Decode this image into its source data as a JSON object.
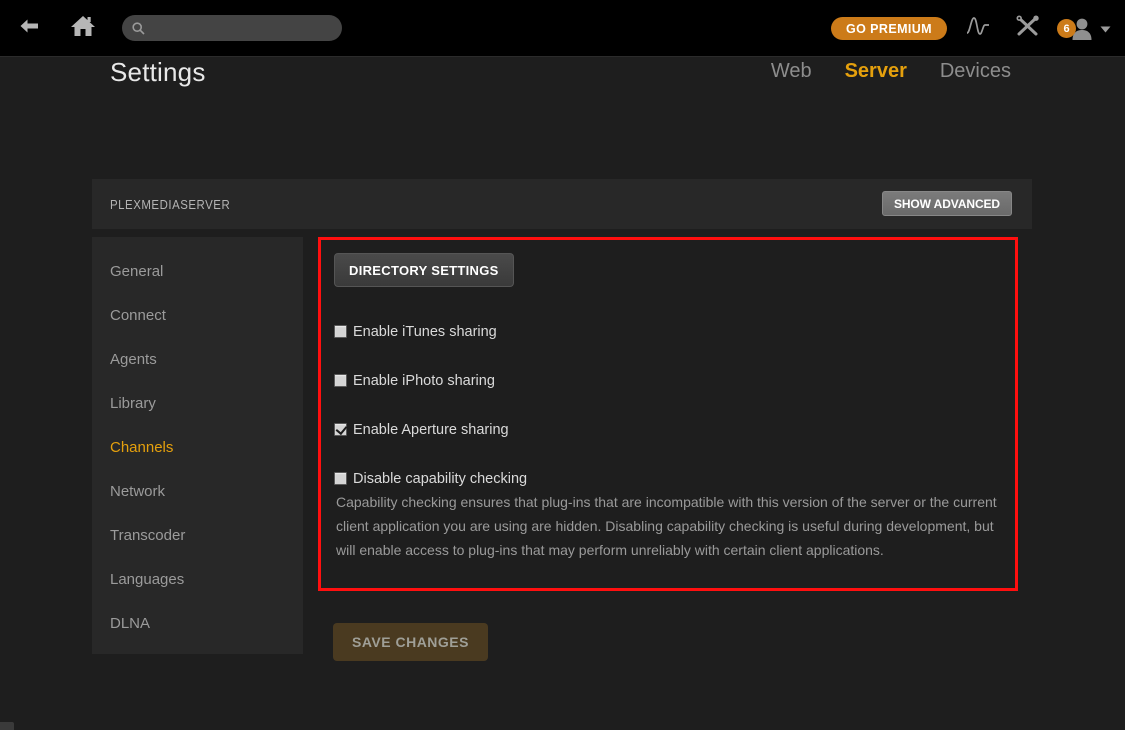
{
  "topbar": {
    "back_icon": "arrow-left-icon",
    "home_icon": "home-icon",
    "search": {
      "icon": "search-icon",
      "value": "",
      "placeholder": ""
    },
    "go_premium_label": "GO PREMIUM",
    "activity_icon": "activity-pulse-icon",
    "tools_icon": "tools-wrench-screwdriver-icon",
    "user": {
      "badge_count": "6",
      "avatar_icon": "user-avatar-icon",
      "chevron_icon": "chevron-down-icon"
    }
  },
  "page": {
    "title": "Settings",
    "tabs": [
      {
        "label": "Web",
        "active": false
      },
      {
        "label": "Server",
        "active": true
      },
      {
        "label": "Devices",
        "active": false
      }
    ]
  },
  "panel": {
    "server_name": "PLEXMEDIASERVER",
    "show_advanced_label": "SHOW ADVANCED"
  },
  "sidebar": {
    "items": [
      {
        "label": "General",
        "active": false
      },
      {
        "label": "Connect",
        "active": false
      },
      {
        "label": "Agents",
        "active": false
      },
      {
        "label": "Library",
        "active": false
      },
      {
        "label": "Channels",
        "active": true
      },
      {
        "label": "Network",
        "active": false
      },
      {
        "label": "Transcoder",
        "active": false
      },
      {
        "label": "Languages",
        "active": false
      },
      {
        "label": "DLNA",
        "active": false
      }
    ]
  },
  "content": {
    "directory_settings_label": "DIRECTORY SETTINGS",
    "checkboxes": [
      {
        "label": "Enable iTunes sharing",
        "checked": false
      },
      {
        "label": "Enable iPhoto sharing",
        "checked": false
      },
      {
        "label": "Enable Aperture sharing",
        "checked": true
      },
      {
        "label": "Disable capability checking",
        "checked": false
      }
    ],
    "help_text": "Capability checking ensures that plug-ins that are incompatible with this version of the server or the current client application you are using are hidden. Disabling capability checking is useful during development, but will enable access to plug-ins that may perform unreliably with certain client applications.",
    "highlight_color": "#ff0f0f"
  },
  "footer": {
    "save_label": "SAVE CHANGES"
  },
  "colors": {
    "accent": "#e5a00d",
    "premium": "#cc7b19",
    "topbar_bg": "#000000",
    "page_bg": "#1e1e1e",
    "panel_bg": "#282828"
  }
}
